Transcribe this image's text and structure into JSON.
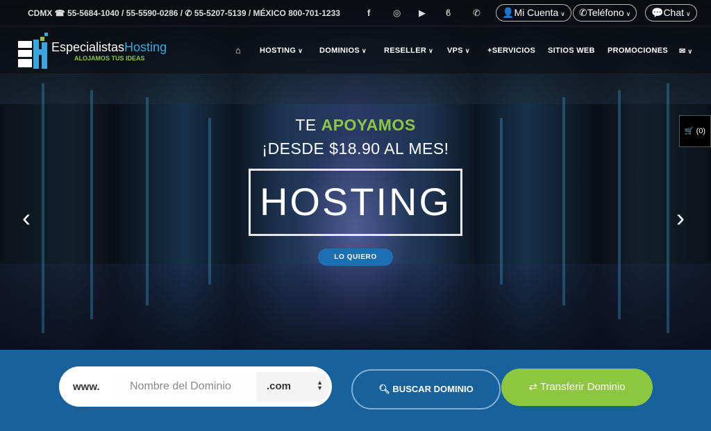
{
  "topbar": {
    "contact": "CDMX ☎ 55-5684-1040 / 55-5590-0286 / ✆ 55-5207-5139 / MÉXICO 800-701-1233",
    "social": [
      "facebook-icon",
      "instagram-icon",
      "youtube-icon",
      "blog-icon",
      "whatsapp-icon"
    ],
    "account": "Mi Cuenta",
    "phone": "Teléfono",
    "chat": "Chat"
  },
  "logo": {
    "name_a": "Especialistas",
    "name_b": "Hosting",
    "tagline": "ALOJAMOS TUS IDEAS"
  },
  "nav": {
    "items": [
      "HOSTING",
      "DOMINIOS",
      "RESELLER",
      "VPS",
      "+SERVICIOS",
      "SITIOS WEB",
      "PROMOCIONES"
    ]
  },
  "hero": {
    "line1_a": "TE ",
    "line1_b": "APOYAMOS",
    "line2": "¡DESDE $18.90 AL MES!",
    "title": "HOSTING",
    "cta": "LO QUIERO"
  },
  "cart": {
    "label": "(0)"
  },
  "search": {
    "prefix": "www.",
    "placeholder": "Nombre del Dominio",
    "tld": ".com",
    "search_label": "BUSCAR DOMINIO",
    "transfer_label": "Transferir Dominio"
  },
  "colors": {
    "green": "#8dc63f",
    "blue": "#17629c",
    "button": "#1d6fb4"
  }
}
